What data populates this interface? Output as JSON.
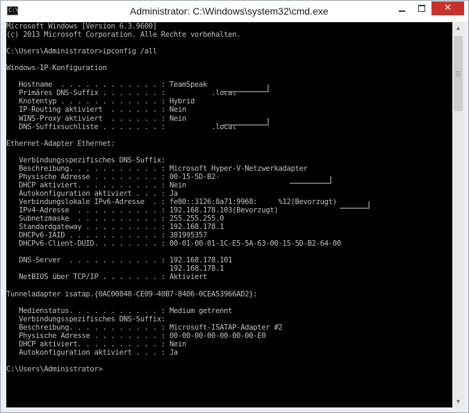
{
  "window": {
    "title": "Administrator: C:\\Windows\\system32\\cmd.exe",
    "icon": "cmd-icon",
    "icon_glyph": "C:\\",
    "controls": {
      "minimize": "minimize-icon",
      "maximize": "maximize-icon",
      "close": "close-icon",
      "close_glyph": "✕"
    }
  },
  "console": {
    "lines": [
      "Microsoft Windows [Version 6.3.9600]",
      "(c) 2013 Microsoft Corporation. Alle Rechte vorbehalten.",
      "",
      "C:\\Users\\Administrator>ipconfig /all",
      "",
      "Windows-IP-Konfiguration",
      "",
      "   Hostname  . . . . . . . . . . . . : TeamSpeak",
      "   Primäres DNS-Suffix . . . . . . . :           .local",
      "   Knotentyp . . . . . . . . . . . . : Hybrid",
      "   IP-Routing aktiviert  . . . . . . : Nein",
      "   WINS-Proxy aktiviert  . . . . . . : Nein",
      "   DNS-Suffixsuchliste . . . . . . . :           .local",
      "",
      "Ethernet-Adapter Ethernet:",
      "",
      "   Verbindungsspezifisches DNS-Suffix:",
      "   Beschreibung. . . . . . . . . . . : Microsoft Hyper-V-Netzwerkadapter",
      "   Physische Adresse . . . . . . . . : 00-15-5D-B2-",
      "   DHCP aktiviert. . . . . . . . . . : Nein",
      "   Autokonfiguration aktiviert . . . : Ja",
      "   Verbindungslokale IPv6-Adresse  . : fe80::3126:8a71:9968:     %12(Bevorzugt)",
      "   IPv4-Adresse  . . . . . . . . . . : 192.168.178.103(Bevorzugt)",
      "   Subnetzmaske  . . . . . . . . . . : 255.255.255.0",
      "   Standardgateway . . . . . . . . . : 192.168.178.1",
      "   DHCPv6-IAID . . . . . . . . . . . : 301995357",
      "   DHCPv6-Client-DUID. . . . . . . . : 00-01-00-01-1C-E5-5A-63-00-15-5D-B2-64-00",
      "",
      "   DNS-Server  . . . . . . . . . . . : 192.168.178.101",
      "                                       192.168.178.1",
      "   NetBIOS über TCP/IP . . . . . . . : Aktiviert",
      "",
      "Tunneladapter isatap.{0AC00840-CE09-40B7-8406-0CEA53966AD2}:",
      "",
      "   Medienstatus. . . . . . . . . . . : Medium getrennt",
      "   Verbindungsspezifisches DNS-Suffix:",
      "   Beschreibung. . . . . . . . . . . : Microsoft-ISATAP-Adapter #2",
      "   Physische Adresse . . . . . . . . : 00-00-00-00-00-00-00-E0",
      "   DHCP aktiviert. . . . . . . . . . : Nein",
      "   Autokonfiguration aktiviert . . . : Ja",
      "",
      "C:\\Users\\Administrator>"
    ]
  },
  "colors": {
    "console_bg": "#000000",
    "console_text": "#c0c0c0",
    "close_button": "#c7332c"
  },
  "scrollbar": {
    "up": "scroll-up-icon",
    "down": "scroll-down-icon",
    "up_glyph": "▲",
    "down_glyph": "▼"
  }
}
